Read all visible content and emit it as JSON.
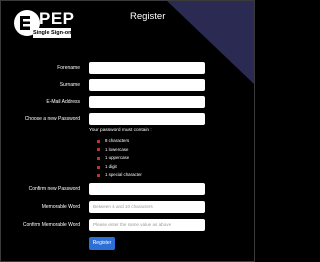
{
  "logo": {
    "main": "PEP",
    "sub": "Single Sign-on"
  },
  "title": "Register",
  "fields": {
    "forename": {
      "label": "Forename",
      "value": ""
    },
    "surname": {
      "label": "Surname",
      "value": ""
    },
    "email": {
      "label": "E-Mail Address",
      "value": ""
    },
    "password": {
      "label": "Choose a new Password",
      "value": ""
    },
    "confirm_password": {
      "label": "Confirm new Password",
      "value": ""
    },
    "memorable_word": {
      "label": "Memorable Word",
      "placeholder": "Between 4 and 10 characters"
    },
    "confirm_memorable_word": {
      "label": "Confirm Memorable Word",
      "placeholder": "Please enter the same value as above"
    }
  },
  "password_rules": {
    "heading": "Your password must contain :",
    "items": [
      "8 characters",
      "1 lowercase",
      "1 uppercase",
      "1 digit",
      "1 special character"
    ]
  },
  "submit_label": "Register",
  "colors": {
    "background": "#000000",
    "accent_triangle": "#2a2a52",
    "bullet": "#c03030",
    "button": "#2c6fd6"
  }
}
